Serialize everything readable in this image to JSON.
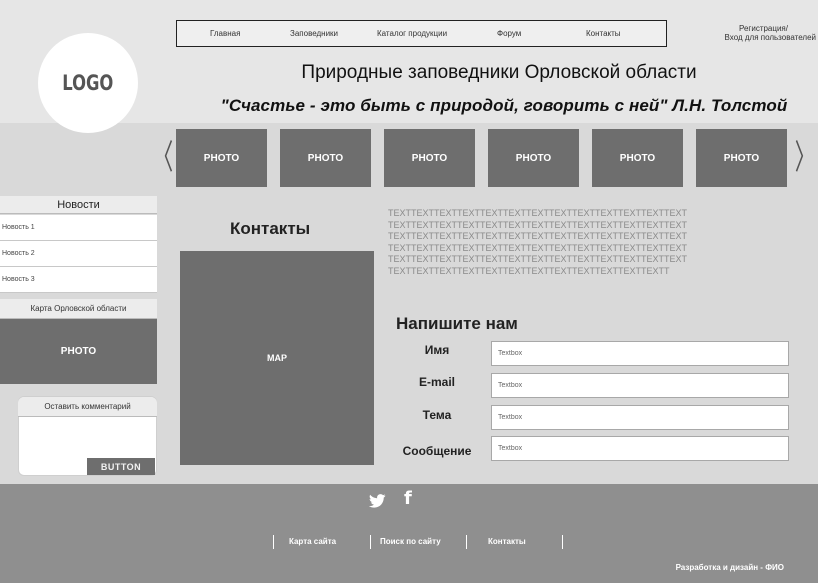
{
  "header": {
    "logo": "LOGO",
    "nav": [
      "Главная",
      "Заповедники",
      "Каталог продукции",
      "Форум",
      "Контакты"
    ],
    "auth_line1": "Регистрация/",
    "auth_line2": "Вход для пользователей",
    "title": "Природные заповедники Орловской области",
    "quote": "\"Счастье - это быть с природой, говорить с ней\" Л.Н. Толстой"
  },
  "carousel": {
    "prev_icon": "chevron-left-icon",
    "next_icon": "chevron-right-icon",
    "prev_glyph": "〈",
    "next_glyph": "〉",
    "photos": [
      "PHOTO",
      "PHOTO",
      "PHOTO",
      "PHOTO",
      "PHOTO",
      "PHOTO"
    ]
  },
  "sidebar": {
    "news_title": "Новости",
    "news_items": [
      "Новость 1",
      "Новость 2",
      "Новость 3"
    ],
    "map_title": "Карта Орловской области",
    "map_photo": "PHOTO",
    "comment_title": "Оставить комментарий",
    "comment_button": "BUTTON"
  },
  "content": {
    "contacts_title": "Контакты",
    "map_label": "MAP",
    "text_lines": [
      "TEXTTEXTTEXTTEXTTEXTTEXTTEXTTEXTTEXTTEXTTEXTTEXTTEXT",
      "TEXTTEXTTEXTTEXTTEXTTEXTTEXTTEXTTEXTTEXTTEXTTEXTTEXT",
      "TEXTTEXTTEXTTEXTTEXTTEXTTEXTTEXTTEXTTEXTTEXTTEXTTEXT",
      "TEXTTEXTTEXTTEXTTEXTTEXTTEXTTEXTTEXTTEXTTEXTTEXTTEXT",
      "TEXTTEXTTEXTTEXTTEXTTEXTTEXTTEXTTEXTTEXTTEXTTEXTTEXT",
      "TEXTTEXTTEXTTEXTTEXTTEXTTEXTTEXTTEXTTEXTTEXTTEXTT"
    ],
    "write_title": "Напишите нам",
    "form": {
      "name_label": "Имя",
      "email_label": "E-mail",
      "subject_label": "Тема",
      "message_label": "Сообщение",
      "placeholder": "Textbox"
    }
  },
  "footer": {
    "twitter_glyph": "🐦",
    "facebook_glyph": "f",
    "links": [
      "Карта сайта",
      "Поиск по сайту",
      "Контакты"
    ],
    "credits": "Разработка и дизайн - ФИО"
  },
  "colors": {
    "header_bg": "#e6e6e6",
    "main_bg": "#d9d9d9",
    "tile": "#6e6e6e",
    "footer_bg": "#8f8f8f"
  }
}
